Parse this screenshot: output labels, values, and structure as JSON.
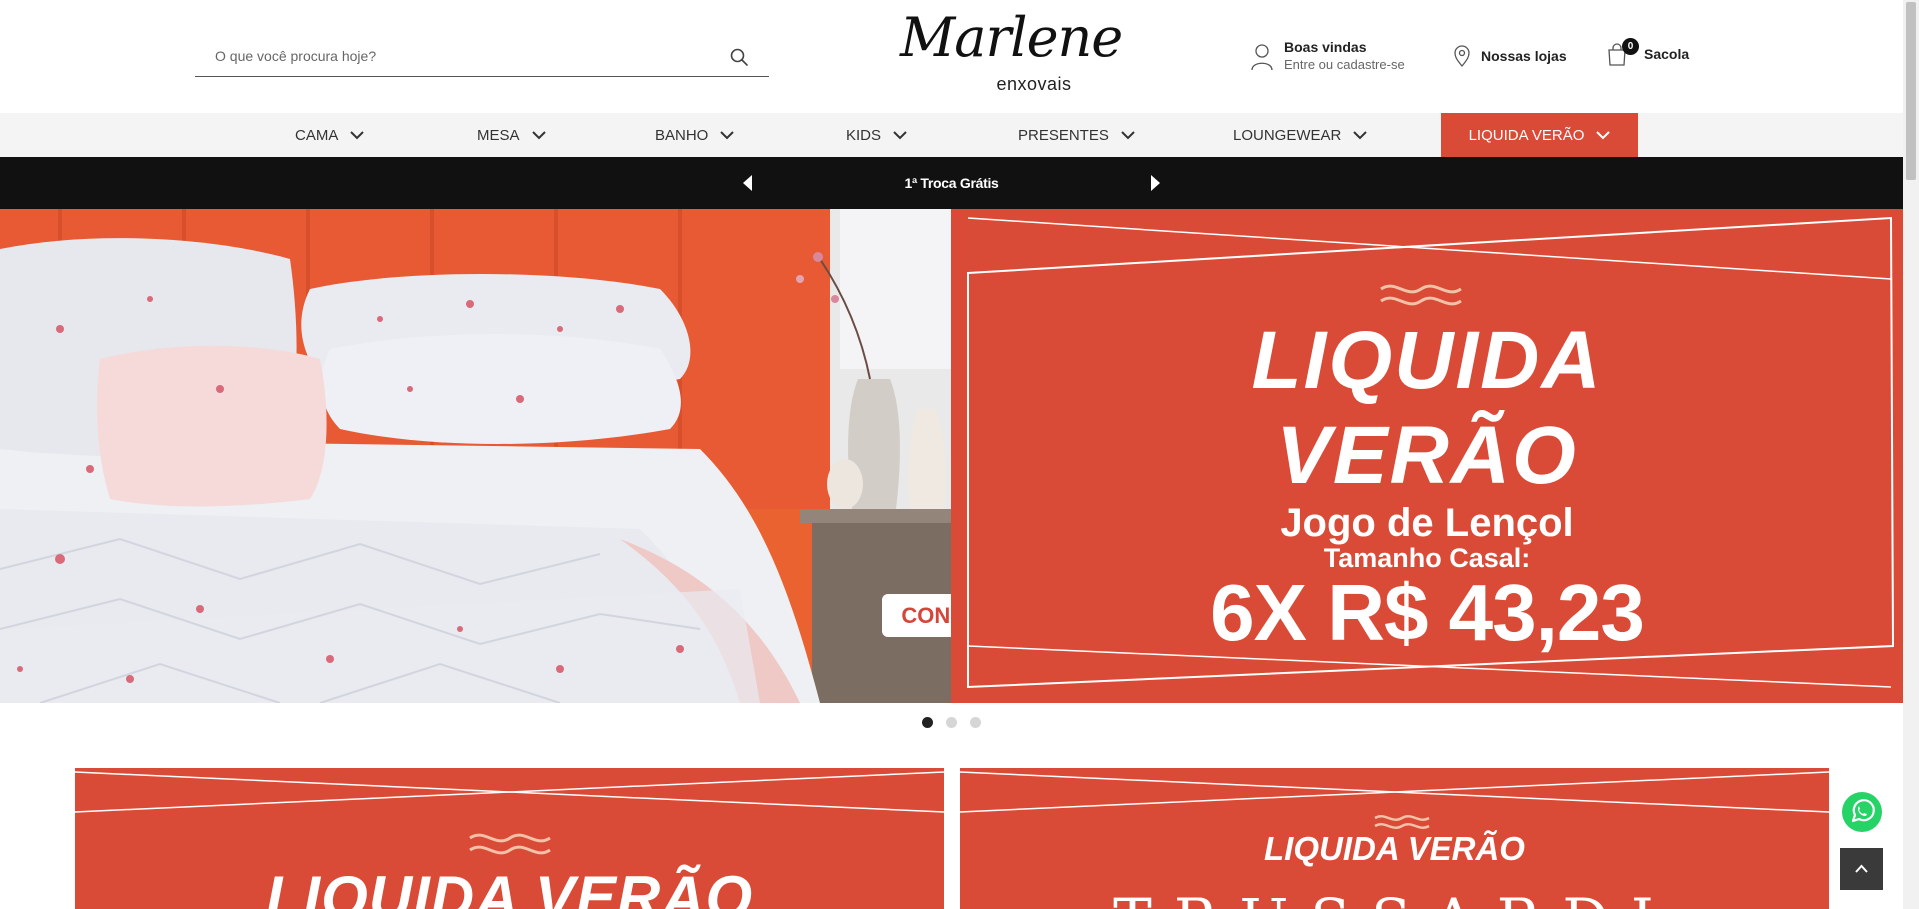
{
  "header": {
    "search": {
      "placeholder": "O que você procura hoje?",
      "value": ""
    },
    "logo": {
      "script": "Marlene",
      "sub": "enxovais"
    },
    "account": {
      "title": "Boas vindas",
      "subtitle": "Entre ou cadastre-se"
    },
    "stores": {
      "label": "Nossas lojas"
    },
    "bag": {
      "label": "Sacola",
      "count": "0"
    }
  },
  "nav": {
    "items": [
      {
        "label": "CAMA"
      },
      {
        "label": "MESA"
      },
      {
        "label": "BANHO"
      },
      {
        "label": "KIDS"
      },
      {
        "label": "PRESENTES"
      },
      {
        "label": "LOUNGEWEAR"
      },
      {
        "label": "LIQUIDA VERÃO"
      }
    ],
    "accent_color": "#d94b37"
  },
  "promo_strip": {
    "message": "1ª Troca Grátis"
  },
  "hero": {
    "line1": "LIQUIDA",
    "line2": "VERÃO",
    "line3": "Jogo de Lençol",
    "line4": "Tamanho Casal:",
    "price": "6X R$ 43,23",
    "cta": "CONFIRA",
    "slides_total": 3,
    "active_slide": 1
  },
  "banners": {
    "left": {
      "title": "LIQUIDA VERÃO"
    },
    "right": {
      "title": "LIQUIDA VERÃO",
      "brand": "TRUSSARDI"
    }
  },
  "icons": {
    "search": "search-icon",
    "user": "user-icon",
    "location": "location-pin-icon",
    "bag": "shopping-bag-icon",
    "whatsapp": "whatsapp-icon",
    "back_to_top": "chevron-up-icon"
  }
}
